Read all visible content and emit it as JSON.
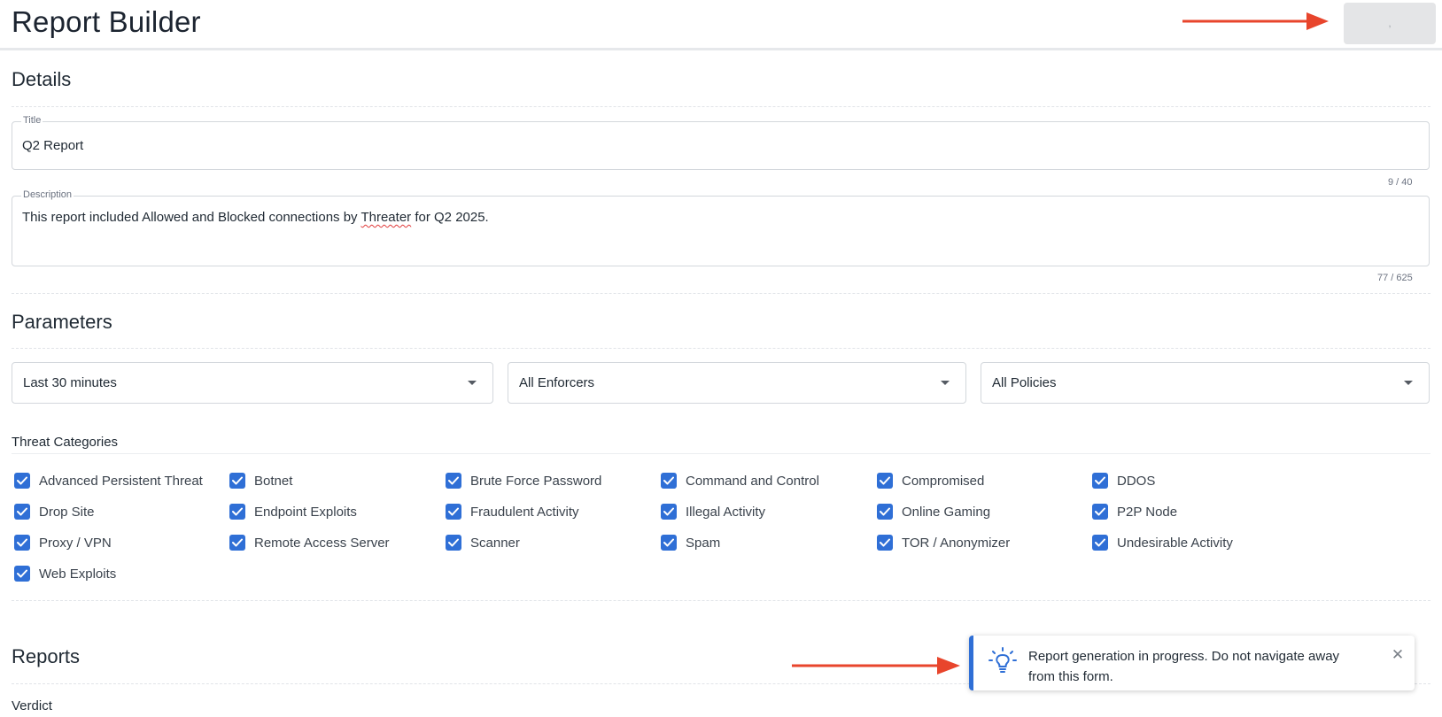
{
  "header": {
    "title": "Report Builder",
    "action_button_label": ","
  },
  "details": {
    "section_title": "Details",
    "title_field": {
      "label": "Title",
      "value": "Q2 Report",
      "counter": "9 / 40"
    },
    "description_field": {
      "label": "Description",
      "value_before": "This report included Allowed and Blocked connections by ",
      "value_misspelled": "Threater",
      "value_after": " for Q2 2025.",
      "counter": "77 / 625"
    }
  },
  "parameters": {
    "section_title": "Parameters",
    "time_range": "Last 30 minutes",
    "enforcers": "All Enforcers",
    "policies": "All Policies",
    "threat_categories_title": "Threat Categories",
    "threat_categories": [
      {
        "label": "Advanced Persistent Threat",
        "checked": true
      },
      {
        "label": "Botnet",
        "checked": true
      },
      {
        "label": "Brute Force Password",
        "checked": true
      },
      {
        "label": "Command and Control",
        "checked": true
      },
      {
        "label": "Compromised",
        "checked": true
      },
      {
        "label": "DDOS",
        "checked": true
      },
      {
        "label": "Drop Site",
        "checked": true
      },
      {
        "label": "Endpoint Exploits",
        "checked": true
      },
      {
        "label": "Fraudulent Activity",
        "checked": true
      },
      {
        "label": "Illegal Activity",
        "checked": true
      },
      {
        "label": "Online Gaming",
        "checked": true
      },
      {
        "label": "P2P Node",
        "checked": true
      },
      {
        "label": "Proxy / VPN",
        "checked": true
      },
      {
        "label": "Remote Access Server",
        "checked": true
      },
      {
        "label": "Scanner",
        "checked": true
      },
      {
        "label": "Spam",
        "checked": true
      },
      {
        "label": "TOR / Anonymizer",
        "checked": true
      },
      {
        "label": "Undesirable Activity",
        "checked": true
      },
      {
        "label": "Web Exploits",
        "checked": true
      }
    ]
  },
  "reports": {
    "section_title": "Reports",
    "verdict_label": "Verdict"
  },
  "toast": {
    "message": "Report generation in progress. Do not navigate away from this form.",
    "close_symbol": "✕"
  },
  "colors": {
    "accent": "#2f6fd6",
    "annotation_arrow": "#e8452c"
  }
}
